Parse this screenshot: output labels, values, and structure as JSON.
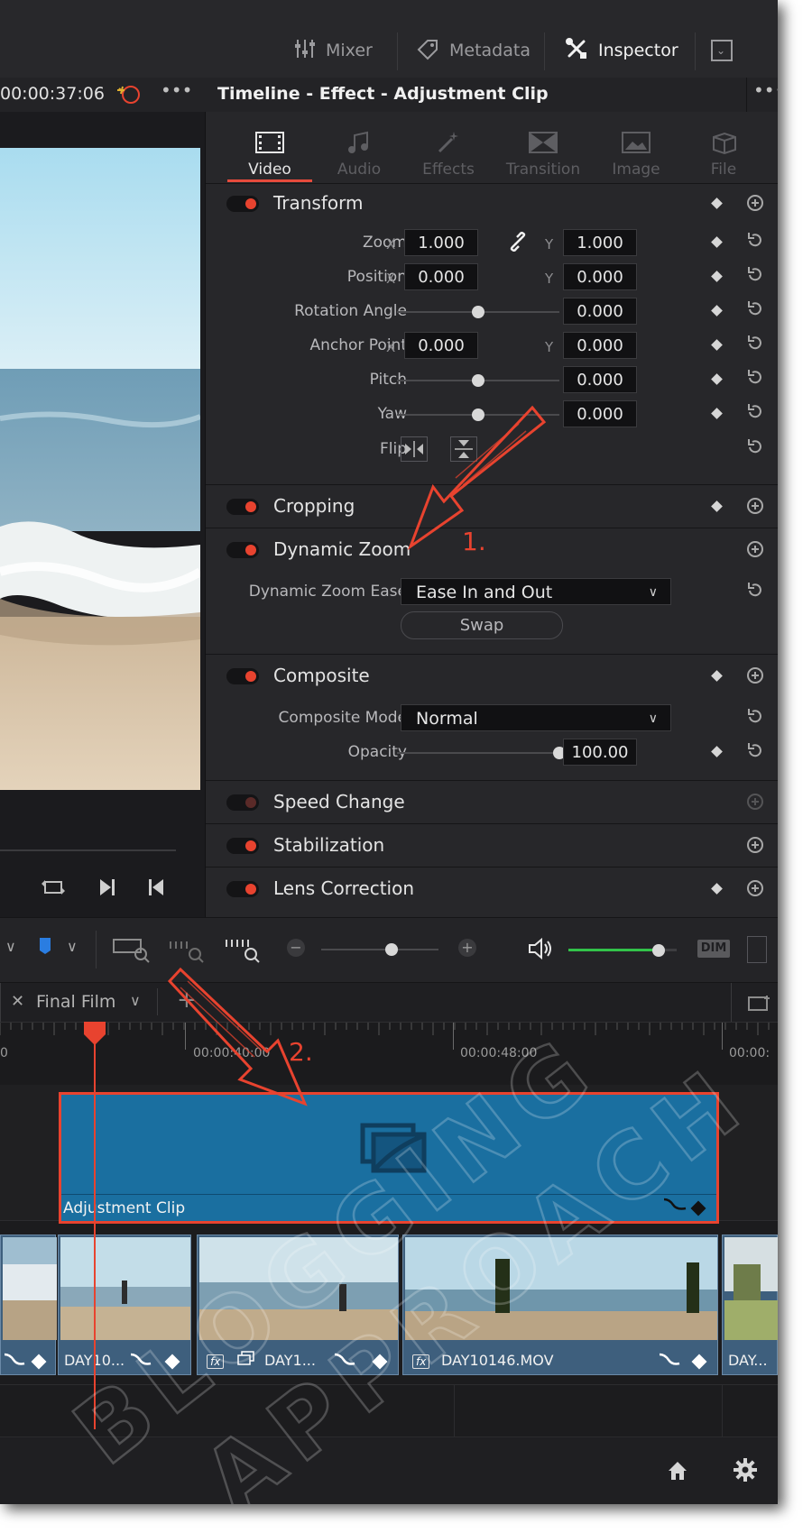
{
  "topbar": {
    "mixer": "Mixer",
    "metadata": "Metadata",
    "inspector": "Inspector"
  },
  "viewer": {
    "timecode": "00:00:37:06"
  },
  "inspector": {
    "header": "Timeline - Effect - Adjustment Clip",
    "tabs": [
      {
        "label": "Video",
        "icon": "film-icon",
        "active": true
      },
      {
        "label": "Audio",
        "icon": "music-note-icon",
        "active": false
      },
      {
        "label": "Effects",
        "icon": "magic-wand-icon",
        "active": false
      },
      {
        "label": "Transition",
        "icon": "transition-icon",
        "active": false
      },
      {
        "label": "Image",
        "icon": "image-icon",
        "active": false
      },
      {
        "label": "File",
        "icon": "file-icon",
        "active": false
      }
    ],
    "transform": {
      "title": "Transform",
      "zoom": {
        "label": "Zoom",
        "x_axis": "X",
        "y_axis": "Y",
        "x": "1.000",
        "y": "1.000"
      },
      "position": {
        "label": "Position",
        "x_axis": "X",
        "y_axis": "Y",
        "x": "0.000",
        "y": "0.000"
      },
      "rotation": {
        "label": "Rotation Angle",
        "value": "0.000",
        "level": 0.5
      },
      "anchor": {
        "label": "Anchor Point",
        "x_axis": "X",
        "y_axis": "Y",
        "x": "0.000",
        "y": "0.000"
      },
      "pitch": {
        "label": "Pitch",
        "value": "0.000",
        "level": 0.5
      },
      "yaw": {
        "label": "Yaw",
        "value": "0.000",
        "level": 0.5
      },
      "flip": {
        "label": "Flip"
      }
    },
    "cropping": {
      "title": "Cropping"
    },
    "dynamic_zoom": {
      "title": "Dynamic Zoom",
      "ease_label": "Dynamic Zoom Ease",
      "ease_value": "Ease In and Out",
      "swap_label": "Swap"
    },
    "composite": {
      "title": "Composite",
      "mode_label": "Composite Mode",
      "mode_value": "Normal",
      "opacity_label": "Opacity",
      "opacity_value": "100.00",
      "opacity_level": 1.0
    },
    "speed_change": {
      "title": "Speed Change"
    },
    "stabilization": {
      "title": "Stabilization"
    },
    "lens_correction": {
      "title": "Lens Correction"
    }
  },
  "timeline_toolbar": {
    "dim_label": "DIM",
    "volume_level": 0.83,
    "zoom_level": 0.6
  },
  "timeline": {
    "tab_name": "Final Film",
    "ruler": [
      "00:00:40:00",
      "00:00:48:00",
      "00:00:"
    ],
    "adjustment_clip": "Adjustment Clip",
    "clips": [
      {
        "name": "",
        "fx": false
      },
      {
        "name": "DAY10...",
        "fx": false
      },
      {
        "name": "DAY1...",
        "fx": true
      },
      {
        "name": "DAY10146.MOV",
        "fx": true
      },
      {
        "name": "DAY..."
      }
    ]
  },
  "annotations": {
    "step1": "1.",
    "step2": "2."
  },
  "colors": {
    "accent_red": "#e8432f",
    "adjustment_clip": "#1a6fa0",
    "video_clip": "#3e5f7d",
    "volume_green": "#32c34a"
  },
  "watermark": "BLOGGING APPROACH"
}
